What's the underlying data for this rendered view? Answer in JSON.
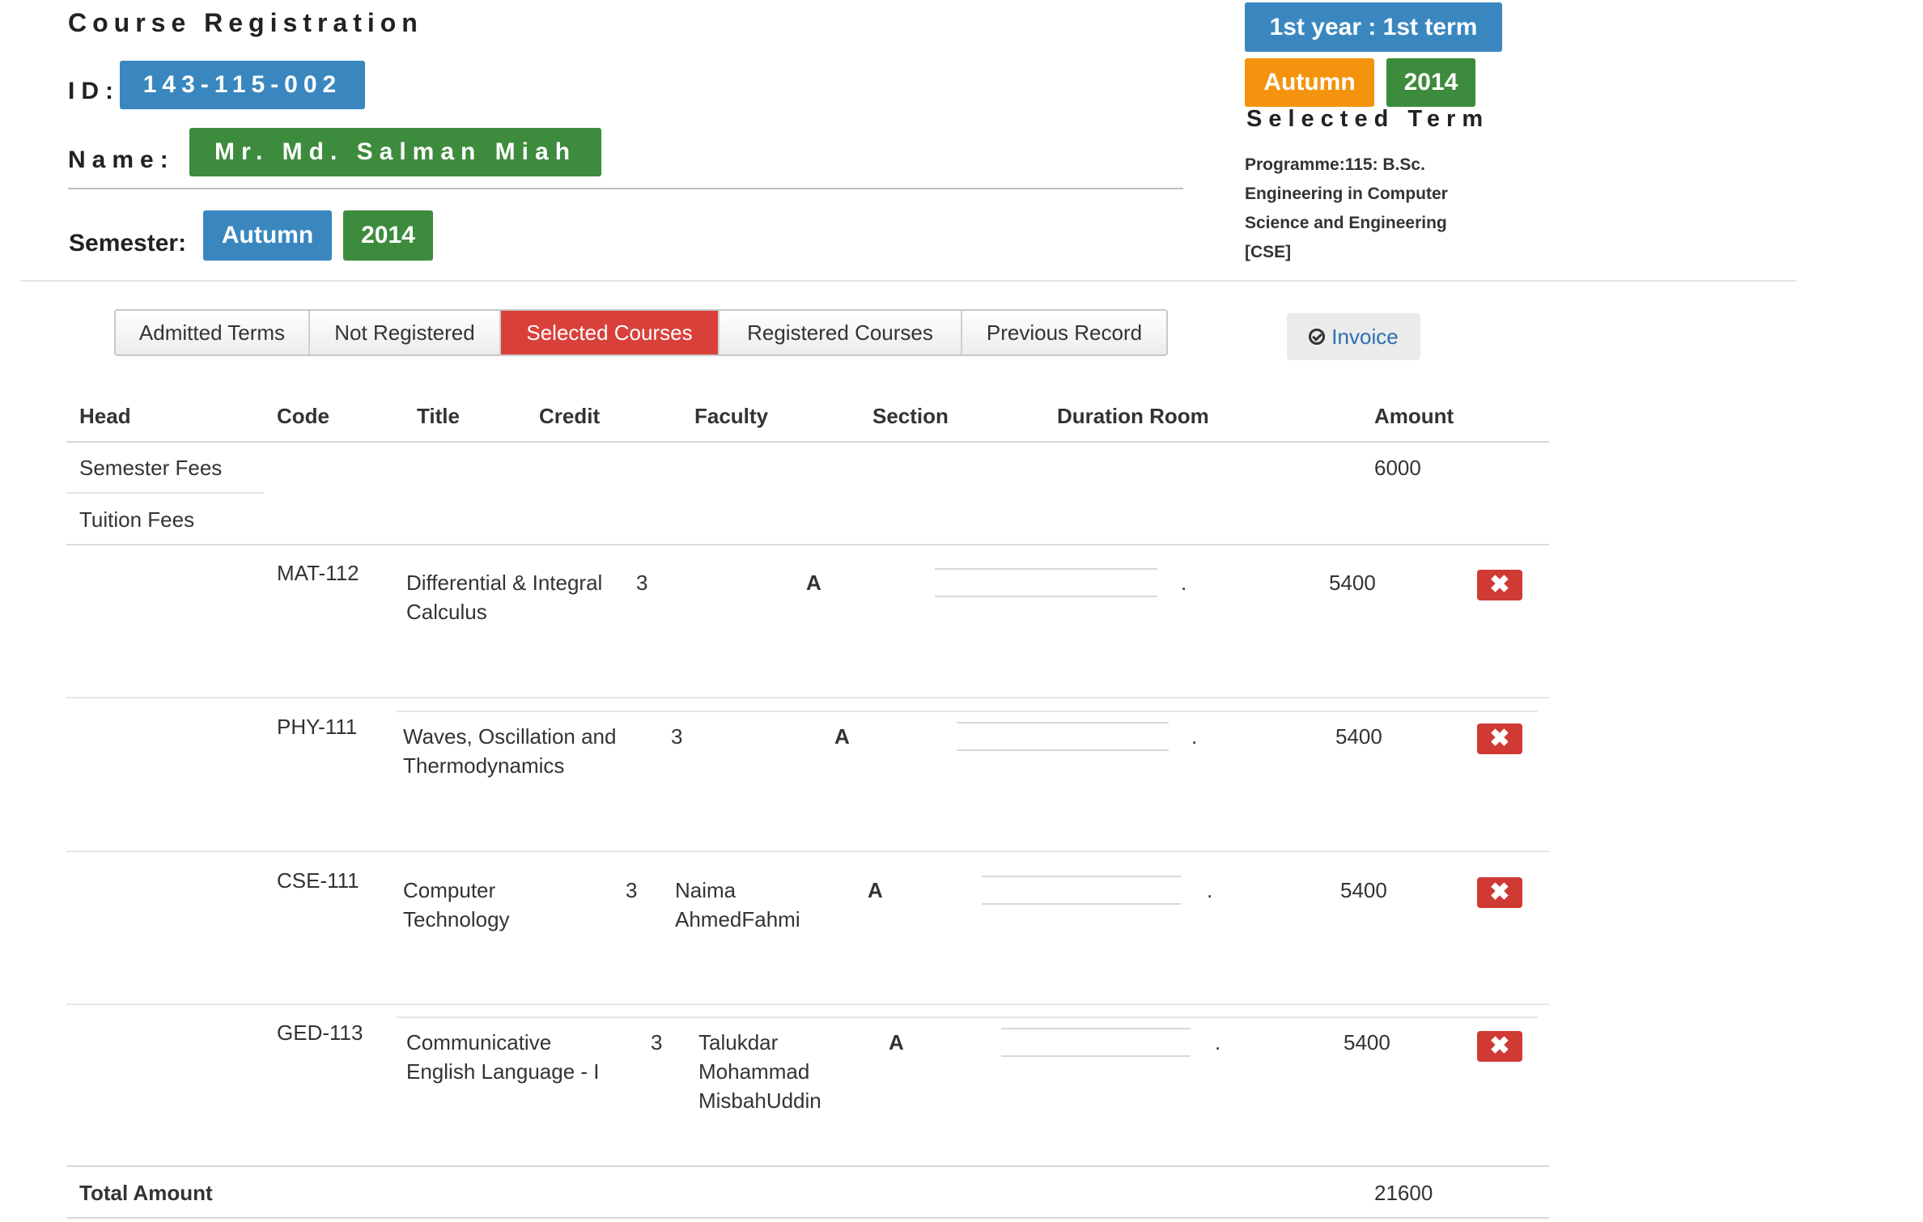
{
  "header": {
    "title": "Course Registration",
    "id_label": "ID:",
    "id_value": "143-115-002",
    "name_label": "Name:",
    "name_value": "Mr. Md. Salman Miah",
    "semester_label": "Semester:",
    "semester_season": "Autumn",
    "semester_year": "2014"
  },
  "term_panel": {
    "year_term": "1st year : 1st term",
    "season": "Autumn",
    "year": "2014",
    "label": "Selected Term",
    "programme": [
      "Programme:115: B.Sc.",
      "Engineering in Computer",
      "Science and Engineering",
      "[CSE]"
    ]
  },
  "tabs": [
    {
      "label": "Admitted Terms",
      "active": false
    },
    {
      "label": "Not Registered",
      "active": false
    },
    {
      "label": "Selected Courses",
      "active": true
    },
    {
      "label": "Registered Courses",
      "active": false
    },
    {
      "label": "Previous Record",
      "active": false
    }
  ],
  "invoice_label": "Invoice",
  "table": {
    "headers": {
      "head": "Head",
      "code": "Code",
      "title": "Title",
      "credit": "Credit",
      "faculty": "Faculty",
      "section": "Section",
      "duration_room": "Duration Room",
      "amount": "Amount"
    },
    "fees": [
      {
        "head": "Semester Fees",
        "amount": "6000"
      },
      {
        "head": "Tuition Fees",
        "amount": ""
      }
    ],
    "courses": [
      {
        "code": "MAT-112",
        "title": [
          "Differential & Integral",
          "Calculus"
        ],
        "credit": "3",
        "faculty": [],
        "section": "A",
        "room": ".",
        "amount": "5400"
      },
      {
        "code": "PHY-111",
        "title": [
          "Waves, Oscillation and",
          "Thermodynamics"
        ],
        "credit": "3",
        "faculty": [],
        "section": "A",
        "room": ".",
        "amount": "5400"
      },
      {
        "code": "CSE-111",
        "title": [
          "Computer",
          "Technology"
        ],
        "credit": "3",
        "faculty": [
          "Naima",
          "AhmedFahmi"
        ],
        "section": "A",
        "room": ".",
        "amount": "5400"
      },
      {
        "code": "GED-113",
        "title": [
          "Communicative",
          "English Language - I"
        ],
        "credit": "3",
        "faculty": [
          "Talukdar",
          "Mohammad",
          "MisbahUddin"
        ],
        "section": "A",
        "room": ".",
        "amount": "5400"
      }
    ],
    "total_label": "Total Amount",
    "total_amount": "21600",
    "delete_icon": "times-icon"
  }
}
